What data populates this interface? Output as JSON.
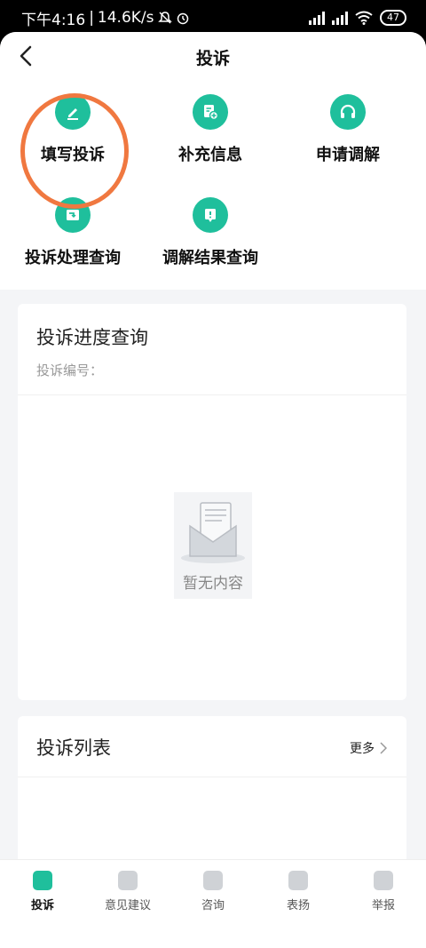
{
  "status_bar": {
    "time": "下午4:16",
    "separator": "|",
    "speed": "14.6K/s",
    "battery": "47"
  },
  "header": {
    "title": "投诉"
  },
  "actions": [
    {
      "label": "填写投诉",
      "icon": "edit-icon"
    },
    {
      "label": "补充信息",
      "icon": "add-document-icon"
    },
    {
      "label": "申请调解",
      "icon": "headset-icon"
    },
    {
      "label": "投诉处理查询",
      "icon": "process-query-icon"
    },
    {
      "label": "调解结果查询",
      "icon": "result-query-icon"
    }
  ],
  "progress_card": {
    "title": "投诉进度查询",
    "subtitle": "投诉编号：",
    "empty_text": "暂无内容"
  },
  "list_card": {
    "title": "投诉列表",
    "more": "更多"
  },
  "tabs": [
    {
      "label": "投诉",
      "active": true
    },
    {
      "label": "意见建议",
      "active": false
    },
    {
      "label": "咨询",
      "active": false
    },
    {
      "label": "表扬",
      "active": false
    },
    {
      "label": "举报",
      "active": false
    }
  ],
  "colors": {
    "accent": "#1fbf9c",
    "highlight": "#f07840"
  }
}
